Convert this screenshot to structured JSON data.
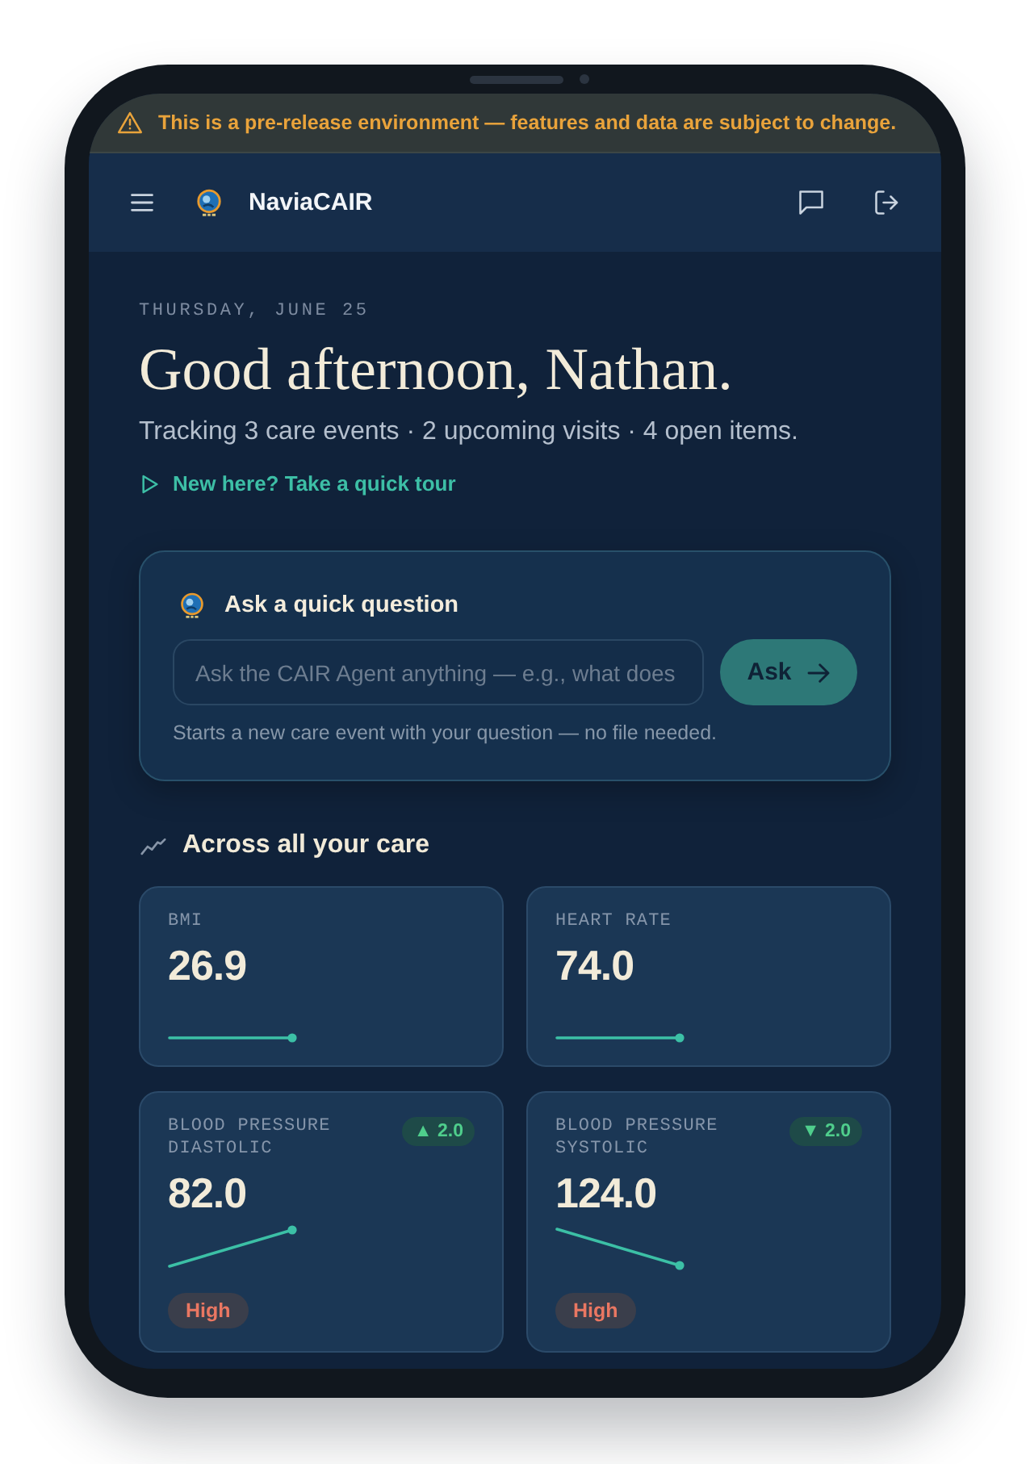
{
  "banner": {
    "text": "This is a pre-release environment — features and data are subject to change."
  },
  "header": {
    "brand": "NaviaCAIR"
  },
  "greeting": {
    "date": "THURSDAY, JUNE 25",
    "title": "Good afternoon, Nathan.",
    "summary": "Tracking 3 care events · 2 upcoming visits · 4 open items.",
    "tour_link": "New here? Take a quick tour"
  },
  "quick_question": {
    "title": "Ask a quick question",
    "placeholder": "Ask the CAIR Agent anything — e.g., what does",
    "button": "Ask",
    "hint": "Starts a new care event with your question — no file needed."
  },
  "overview": {
    "title": "Across all your care",
    "metrics": [
      {
        "kind": "flat",
        "label": "BMI",
        "value": "26.9"
      },
      {
        "kind": "flat",
        "label": "HEART RATE",
        "value": "74.0"
      },
      {
        "kind": "rising",
        "label": "BLOOD PRESSURE DIASTOLIC",
        "value": "82.0",
        "change": "▲ 2.0",
        "flag": "High"
      },
      {
        "kind": "falling",
        "label": "BLOOD PRESSURE SYSTOLIC",
        "value": "124.0",
        "change": "▼ 2.0",
        "flag": "High"
      }
    ]
  }
}
